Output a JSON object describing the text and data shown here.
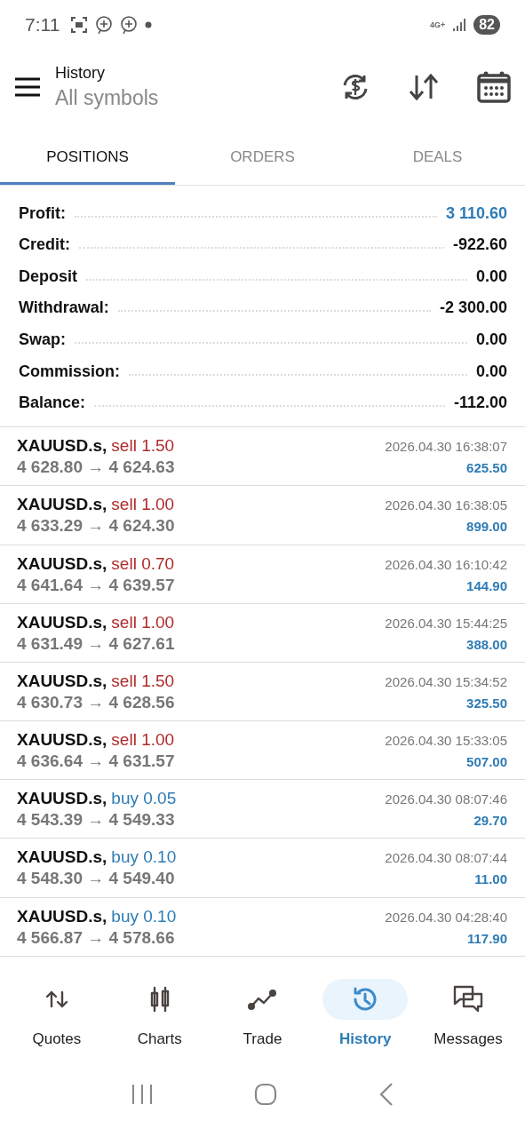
{
  "status_bar": {
    "time": "7:11",
    "network": "4G+",
    "battery": "82"
  },
  "header": {
    "title": "History",
    "subtitle": "All symbols"
  },
  "tabs": [
    {
      "label": "POSITIONS",
      "selected": true
    },
    {
      "label": "ORDERS",
      "selected": false
    },
    {
      "label": "DEALS",
      "selected": false
    }
  ],
  "summary": [
    {
      "label": "Profit:",
      "value": "3 110.60",
      "highlighted": true
    },
    {
      "label": "Credit:",
      "value": "-922.60",
      "highlighted": false
    },
    {
      "label": "Deposit",
      "value": "0.00",
      "highlighted": false
    },
    {
      "label": "Withdrawal:",
      "value": "-2 300.00",
      "highlighted": false
    },
    {
      "label": "Swap:",
      "value": "0.00",
      "highlighted": false
    },
    {
      "label": "Commission:",
      "value": "0.00",
      "highlighted": false
    },
    {
      "label": "Balance:",
      "value": "-112.00",
      "highlighted": false
    }
  ],
  "positions": [
    {
      "symbol": "XAUUSD.s,",
      "kind": "sell",
      "trade": "sell 1.50",
      "prices": "4 628.80 → 4 624.63",
      "time": "2026.04.30 16:38:07",
      "profit": "625.50"
    },
    {
      "symbol": "XAUUSD.s,",
      "kind": "sell",
      "trade": "sell 1.00",
      "prices": "4 633.29 → 4 624.30",
      "time": "2026.04.30 16:38:05",
      "profit": "899.00"
    },
    {
      "symbol": "XAUUSD.s,",
      "kind": "sell",
      "trade": "sell 0.70",
      "prices": "4 641.64 → 4 639.57",
      "time": "2026.04.30 16:10:42",
      "profit": "144.90"
    },
    {
      "symbol": "XAUUSD.s,",
      "kind": "sell",
      "trade": "sell 1.00",
      "prices": "4 631.49 → 4 627.61",
      "time": "2026.04.30 15:44:25",
      "profit": "388.00"
    },
    {
      "symbol": "XAUUSD.s,",
      "kind": "sell",
      "trade": "sell 1.50",
      "prices": "4 630.73 → 4 628.56",
      "time": "2026.04.30 15:34:52",
      "profit": "325.50"
    },
    {
      "symbol": "XAUUSD.s,",
      "kind": "sell",
      "trade": "sell 1.00",
      "prices": "4 636.64 → 4 631.57",
      "time": "2026.04.30 15:33:05",
      "profit": "507.00"
    },
    {
      "symbol": "XAUUSD.s,",
      "kind": "buy",
      "trade": "buy 0.05",
      "prices": "4 543.39 → 4 549.33",
      "time": "2026.04.30 08:07:46",
      "profit": "29.70"
    },
    {
      "symbol": "XAUUSD.s,",
      "kind": "buy",
      "trade": "buy 0.10",
      "prices": "4 548.30 → 4 549.40",
      "time": "2026.04.30 08:07:44",
      "profit": "11.00"
    },
    {
      "symbol": "XAUUSD.s,",
      "kind": "buy",
      "trade": "buy 0.10",
      "prices": "4 566.87 → 4 578.66",
      "time": "2026.04.30 04:28:40",
      "profit": "117.90"
    }
  ],
  "bottom_nav": [
    {
      "label": "Quotes",
      "kind": "quotes",
      "selected": false
    },
    {
      "label": "Charts",
      "kind": "charts",
      "selected": false
    },
    {
      "label": "Trade",
      "kind": "trade",
      "selected": false
    },
    {
      "label": "History",
      "kind": "history",
      "selected": true
    },
    {
      "label": "Messages",
      "kind": "messages",
      "selected": false
    }
  ]
}
